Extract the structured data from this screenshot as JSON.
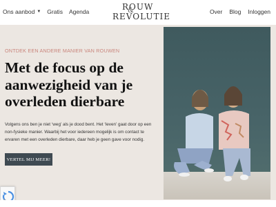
{
  "nav": {
    "left": [
      {
        "label": "Ons aanbod",
        "has_dropdown": true
      },
      {
        "label": "Gratis"
      },
      {
        "label": "Agenda"
      }
    ],
    "right": [
      {
        "label": "Over"
      },
      {
        "label": "Blog"
      },
      {
        "label": "Inloggen"
      }
    ],
    "logo": {
      "line1": "ROUW",
      "line2": "REVOLUTIE",
      "amp": "&"
    }
  },
  "hero": {
    "eyebrow": "ONTDEK EEN ANDERE MANIER VAN ROUWEN",
    "headline": "Met de focus op de aanwezigheid van je overleden dierbare",
    "body": "Volgens ons ben je niet ‘weg’ als je dood bent. Het ‘leven’ gaat door op een non-fysieke manier. Waarbij het voor iedereen mogelijk is om contact te ervaren met een overleden dierbare, daar heb je geen gave voor nodig.",
    "cta_label": "VERTEL MIJ MEER!"
  },
  "colors": {
    "hero_bg": "#ece7e2",
    "eyebrow": "#c9847b",
    "cta_bg": "#3f4a52",
    "photo_wall": "#486468"
  },
  "icons": {
    "dropdown": "chevron-down-icon",
    "recaptcha": "recaptcha-icon"
  }
}
